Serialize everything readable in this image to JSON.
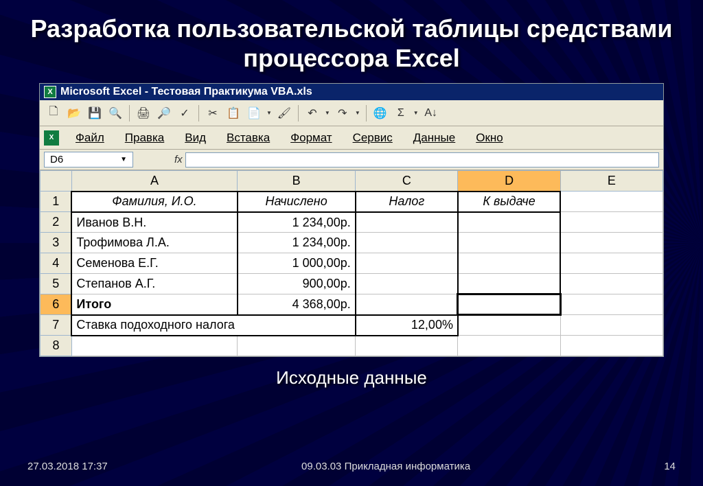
{
  "slide": {
    "title": "Разработка пользовательской таблицы средствами процессора Excel",
    "subtitle": "Исходные данные",
    "footer_date": "27.03.2018 17:37",
    "footer_center": "09.03.03 Прикладная информатика",
    "footer_page": "14"
  },
  "excel": {
    "window_title": "Microsoft Excel - Тестовая Практикума VBA.xls",
    "namebox": "D6",
    "fx_label": "fx",
    "formula_value": "",
    "menu": {
      "file": "Файл",
      "edit": "Правка",
      "view": "Вид",
      "insert": "Вставка",
      "format": "Формат",
      "tools": "Сервис",
      "data": "Данные",
      "window": "Окно"
    },
    "columns": [
      "A",
      "B",
      "C",
      "D",
      "E"
    ],
    "selected_col": "D",
    "selected_row": "6",
    "headers": {
      "name": "Фамилия, И.О.",
      "accrued": "Начислено",
      "tax": "Налог",
      "payout": "К выдаче"
    },
    "rows": [
      {
        "name": "Иванов В.Н.",
        "accrued": "1 234,00р."
      },
      {
        "name": "Трофимова Л.А.",
        "accrued": "1 234,00р."
      },
      {
        "name": "Семенова Е.Г.",
        "accrued": "1 000,00р."
      },
      {
        "name": "Степанов А.Г.",
        "accrued": "900,00р."
      }
    ],
    "total": {
      "label": "Итого",
      "value": "4 368,00р."
    },
    "rate": {
      "label": "Ставка подоходного налога",
      "value": "12,00%"
    }
  },
  "chart_data": {
    "type": "table",
    "title": "Исходные данные",
    "columns": [
      "Фамилия, И.О.",
      "Начислено",
      "Налог",
      "К выдаче"
    ],
    "rows": [
      [
        "Иванов В.Н.",
        "1 234,00р.",
        "",
        ""
      ],
      [
        "Трофимова Л.А.",
        "1 234,00р.",
        "",
        ""
      ],
      [
        "Семенова Е.Г.",
        "1 000,00р.",
        "",
        ""
      ],
      [
        "Степанов А.Г.",
        "900,00р.",
        "",
        ""
      ],
      [
        "Итого",
        "4 368,00р.",
        "",
        ""
      ]
    ],
    "extra": {
      "Ставка подоходного налога": "12,00%"
    }
  }
}
